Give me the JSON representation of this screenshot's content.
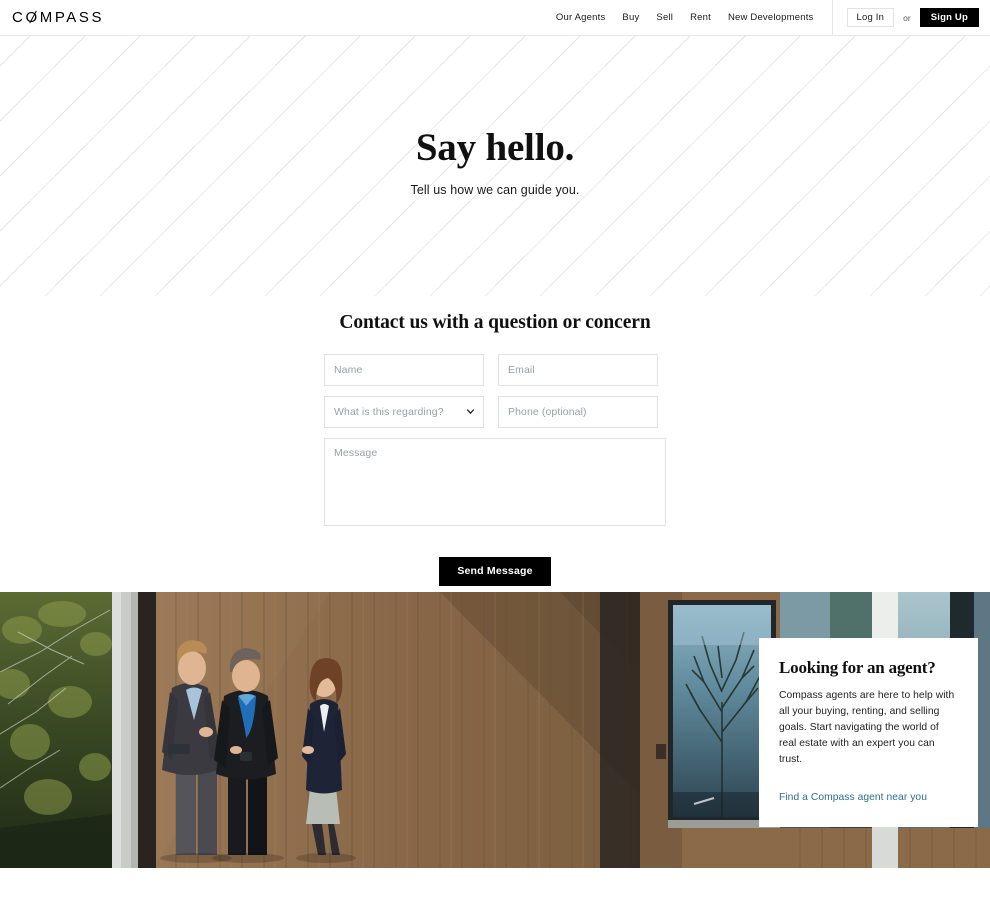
{
  "brand": {
    "name_part1": "C",
    "name_o": "O",
    "name_part2": "MPASS",
    "full_name": "COMPASS"
  },
  "header": {
    "nav_links": [
      {
        "label": "Our Agents"
      },
      {
        "label": "Buy"
      },
      {
        "label": "Sell"
      },
      {
        "label": "Rent"
      },
      {
        "label": "New Developments"
      }
    ],
    "login_label": "Log In",
    "or_label": "or",
    "signup_label": "Sign Up"
  },
  "hero": {
    "title": "Say hello.",
    "subtitle": "Tell us how we can guide you.",
    "background_pattern": "diagonal-stripes",
    "pattern_color": "#787e8c"
  },
  "contact": {
    "title": "Contact us with a question or concern",
    "fields": {
      "name_placeholder": "Name",
      "email_placeholder": "Email",
      "regarding_placeholder": "What is this regarding?",
      "phone_placeholder": "Phone (optional)",
      "message_placeholder": "Message"
    },
    "submit_label": "Send Message"
  },
  "agent_card": {
    "title": "Looking for an agent?",
    "body": "Compass agents are here to help with all your buying, renting, and selling goals. Start navigating the world of real estate with an expert you can trust.",
    "link_label": "Find a Compass agent near you",
    "link_color": "#2c6e8d"
  },
  "photo": {
    "description": "Three business people conversing outside a modern wood-clad building"
  }
}
